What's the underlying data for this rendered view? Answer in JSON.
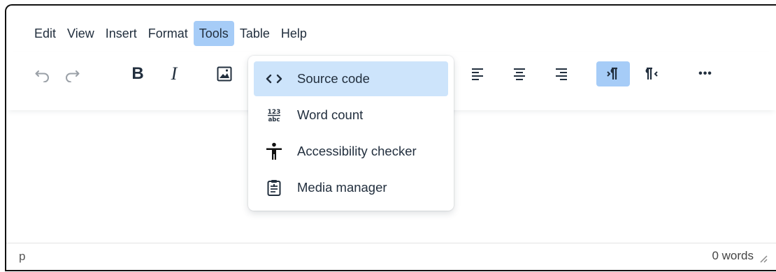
{
  "menubar": {
    "items": [
      {
        "label": "Edit"
      },
      {
        "label": "View"
      },
      {
        "label": "Insert"
      },
      {
        "label": "Format"
      },
      {
        "label": "Tools",
        "active": true
      },
      {
        "label": "Table"
      },
      {
        "label": "Help"
      }
    ]
  },
  "toolbar": {
    "buttons": [
      {
        "name": "undo-icon",
        "state": "disabled"
      },
      {
        "name": "redo-icon",
        "state": "disabled"
      },
      {
        "name": "bold-icon",
        "label": "B"
      },
      {
        "name": "italic-icon",
        "label": "I"
      },
      {
        "name": "image-icon"
      },
      {
        "name": "align-left-icon"
      },
      {
        "name": "align-center-icon"
      },
      {
        "name": "align-right-icon"
      },
      {
        "name": "ltr-icon",
        "state": "active"
      },
      {
        "name": "rtl-icon"
      },
      {
        "name": "more-icon",
        "label": "•••"
      }
    ],
    "accent": "#a6ccf7"
  },
  "tools_menu": {
    "items": [
      {
        "label": "Source code",
        "icon": "source-code-icon",
        "active": true
      },
      {
        "label": "Word count",
        "icon": "word-count-icon"
      },
      {
        "label": "Accessibility checker",
        "icon": "accessibility-icon"
      },
      {
        "label": "Media manager",
        "icon": "media-manager-icon"
      }
    ],
    "highlight": "#cde4fb"
  },
  "statusbar": {
    "path": "p",
    "wordcount": "0 words"
  }
}
